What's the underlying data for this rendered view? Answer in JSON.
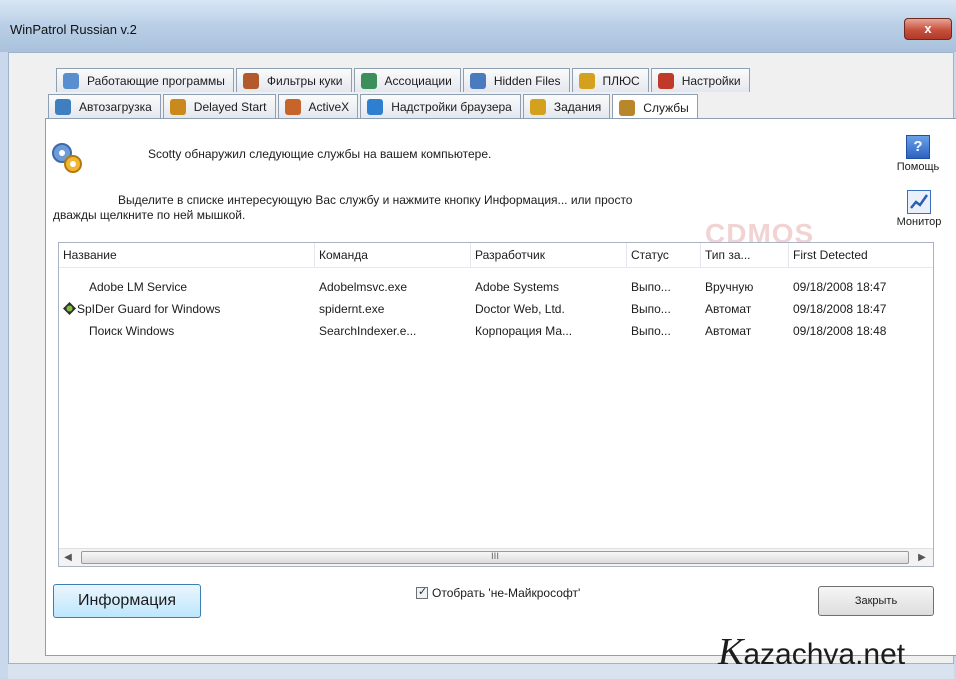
{
  "window": {
    "title": "WinPatrol Russian v.2",
    "close_glyph": "x"
  },
  "tabs_row1": [
    {
      "label": "Работающие программы",
      "color": "#5a8fcf"
    },
    {
      "label": "Фильтры куки",
      "color": "#b35a2d"
    },
    {
      "label": "Ассоциации",
      "color": "#3c8f5a"
    },
    {
      "label": "Hidden Files",
      "color": "#4a7bbf"
    },
    {
      "label": "ПЛЮС",
      "color": "#d4a11f"
    },
    {
      "label": "Настройки",
      "color": "#c0392b"
    }
  ],
  "tabs_row2": [
    {
      "label": "Автозагрузка",
      "color": "#3f7fc0"
    },
    {
      "label": "Delayed Start",
      "color": "#c98a1b"
    },
    {
      "label": "ActiveX",
      "color": "#c7642a"
    },
    {
      "label": "Надстройки браузера",
      "color": "#2f7fd0"
    },
    {
      "label": "Задания",
      "color": "#d4a11f"
    },
    {
      "label": "Службы",
      "color": "#b8862b"
    }
  ],
  "active_tab": "Службы",
  "description": {
    "line1": "Scotty обнаружил следующие службы на вашем компьютере.",
    "line2": "Выделите в списке интересующую Вас службу и нажмите кнопку Информация... или просто",
    "line3": "дважды щелкните по ней мышкой."
  },
  "side": {
    "help_label": "Помощь",
    "help_glyph": "?",
    "monitor_label": "Монитор"
  },
  "watermark": "CDMOS",
  "list": {
    "columns": [
      "Название",
      "Команда",
      "Разработчик",
      "Статус",
      "Тип за...",
      "First Detected"
    ],
    "rows": [
      {
        "name": "Adobe LM Service",
        "command": "Adobelmsvc.exe",
        "developer": "Adobe Systems",
        "status": "Выпо...",
        "type": "Вручную",
        "detected": "09/18/2008 18:47",
        "icon": "none"
      },
      {
        "name": "SpIDer Guard for Windows",
        "command": "spidernt.exe",
        "developer": "Doctor Web, Ltd.",
        "status": "Выпо...",
        "type": "Автомат",
        "detected": "09/18/2008 18:47",
        "icon": "spider-icon"
      },
      {
        "name": "Поиск Windows",
        "command": "SearchIndexer.e...",
        "developer": "Корпорация Ма...",
        "status": "Выпо...",
        "type": "Автомат",
        "detected": "09/18/2008 18:48",
        "icon": "none"
      }
    ],
    "scroll_thumb_glyph": "III"
  },
  "buttons": {
    "info": "Информация",
    "close": "Закрыть"
  },
  "checkbox": {
    "label": "Отобрать 'не-Майкрософт'",
    "checked": true
  },
  "brand": {
    "initial": "K",
    "rest": "azachya.net"
  }
}
